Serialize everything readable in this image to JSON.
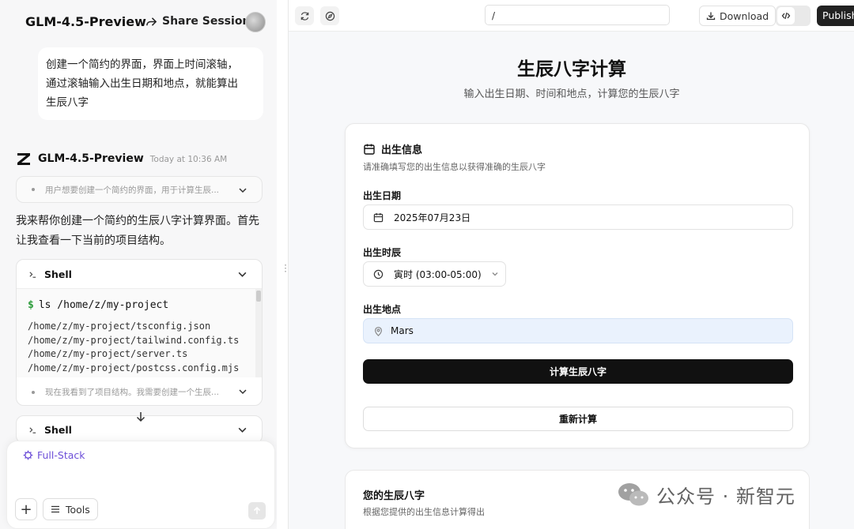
{
  "left_panel": {
    "app_title": "GLM-4.5-Preview",
    "share_label": "Share Session",
    "user_message_lines": [
      "创建一个简约的界面，界面上时间滚轴，",
      "通过滚轴输入出生日期和地点，就能算出",
      "生辰八字"
    ],
    "model_name": "GLM-4.5-Preview",
    "model_time": "Today at 10:36 AM",
    "thought_1": "用户想要创建一个简约的界面，用于计算生辰...",
    "assistant_text": "我来帮你创建一个简约的生辰八字计算界面。首先让我查看一下当前的项目结构。",
    "shell_1": {
      "label": "Shell",
      "command": "ls /home/z/my-project",
      "output": [
        "/home/z/my-project/tsconfig.json",
        "/home/z/my-project/tailwind.config.ts",
        "/home/z/my-project/server.ts",
        "/home/z/my-project/postcss.config.mjs"
      ],
      "thought": "现在我看到了项目结构。我需要创建一个生辰..."
    },
    "shell_2": {
      "label": "Shell"
    },
    "composer": {
      "mode_label": "Full-Stack",
      "plus_label": "+",
      "tools_label": "Tools"
    }
  },
  "right_panel": {
    "url_value": "/",
    "download_label": "Download",
    "publish_label": "Publish",
    "page_title": "生辰八字计算",
    "page_subtitle": "输入出生日期、时间和地点，计算您的生辰八字",
    "form_card": {
      "title": "出生信息",
      "description": "请准确填写您的出生信息以获得准确的生辰八字",
      "date_label": "出生日期",
      "date_value": "2025年07月23日",
      "time_label": "出生时辰",
      "time_value": "寅时 (03:00-05:00)",
      "place_label": "出生地点",
      "place_value": "Mars",
      "calculate_label": "计算生辰八字",
      "reset_label": "重新计算"
    },
    "result_card": {
      "title": "您的生辰八字",
      "description": "根据您提供的出生信息计算得出"
    }
  },
  "watermark": {
    "text": "公众号 · 新智元"
  },
  "colors": {
    "accent_purple": "#6d4fd8",
    "primary_black": "#111111",
    "place_highlight": "#eaf2fd",
    "shell_prompt_green": "#2d9c3c"
  },
  "icons": [
    "share-icon",
    "z-logo-icon",
    "chevron-down-icon",
    "terminal-icon",
    "arrow-down-icon",
    "sparkle-icon",
    "plus-icon",
    "list-icon",
    "send-icon",
    "refresh-icon",
    "compass-icon",
    "download-icon",
    "code-icon",
    "calendar-icon",
    "clock-icon",
    "map-pin-icon",
    "wechat-icon"
  ]
}
